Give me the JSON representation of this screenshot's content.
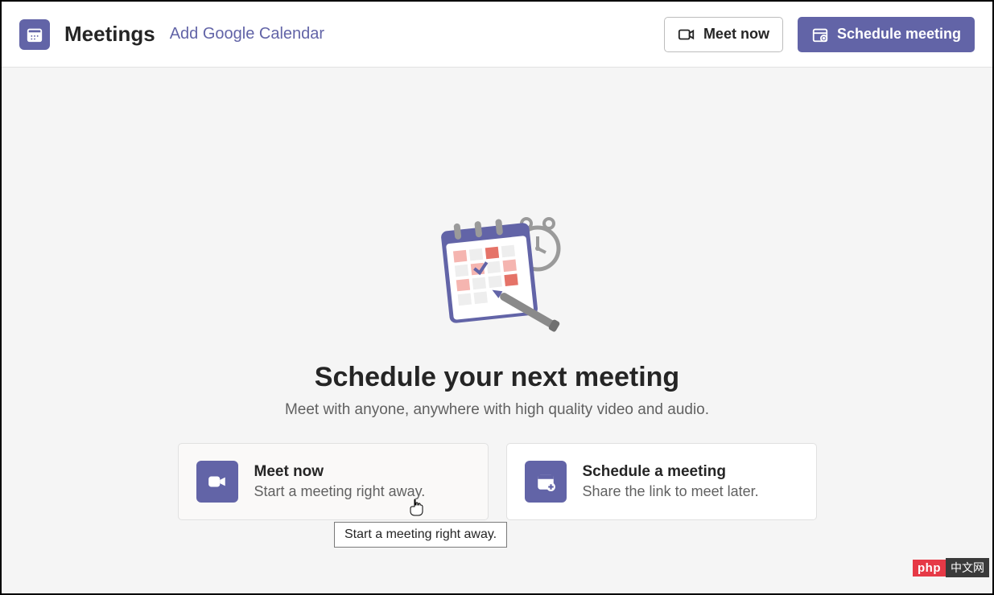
{
  "header": {
    "title": "Meetings",
    "add_calendar_link": "Add Google Calendar",
    "meet_now_label": "Meet now",
    "schedule_label": "Schedule meeting"
  },
  "hero": {
    "title": "Schedule your next meeting",
    "subtitle": "Meet with anyone, anywhere with high quality video and audio."
  },
  "cards": {
    "meet_now": {
      "title": "Meet now",
      "subtitle": "Start a meeting right away."
    },
    "schedule": {
      "title": "Schedule a meeting",
      "subtitle": "Share the link to meet later."
    }
  },
  "tooltip": "Start a meeting right away.",
  "badge": {
    "left": "php",
    "right": "中文网"
  }
}
